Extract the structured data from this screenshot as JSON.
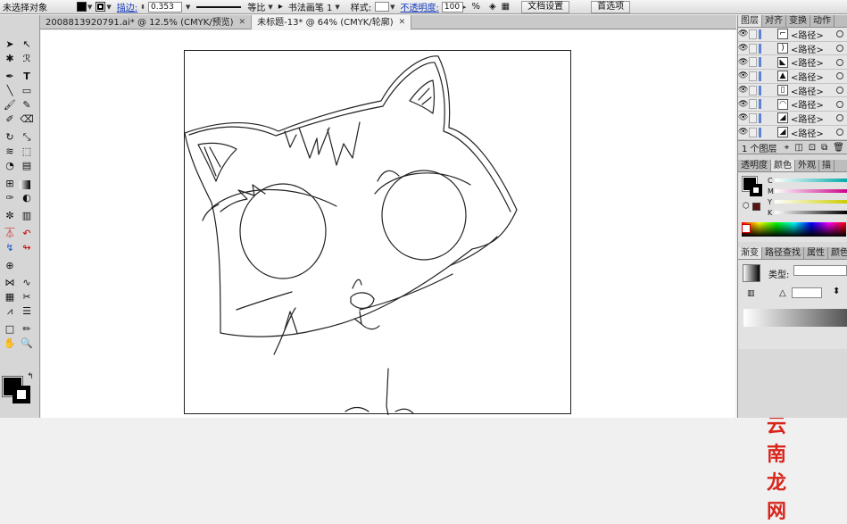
{
  "control_bar": {
    "selection_label": "未选择对象",
    "stroke_label": "描边:",
    "stroke_value": "0.353",
    "profile_label": "等比",
    "brush_label": "书法画笔 1",
    "style_label": "样式:",
    "opacity_label": "不透明度:",
    "opacity_value": "100",
    "percent": "%",
    "doc_setup_button": "文档设置",
    "preferences_button": "首选项"
  },
  "doc_tabs": [
    {
      "label": "2008813920791.ai* @ 12.5% (CMYK/预览)"
    },
    {
      "label": "未标题-13* @ 64% (CMYK/轮廓)"
    }
  ],
  "layers_panel": {
    "tabs": [
      "图层",
      "对齐",
      "变换",
      "动作"
    ],
    "rows": [
      {
        "label": "<路径>"
      },
      {
        "label": "<路径>"
      },
      {
        "label": "<路径>"
      },
      {
        "label": "<路径>"
      },
      {
        "label": "<路径>"
      },
      {
        "label": "<路径>"
      },
      {
        "label": "<路径>"
      },
      {
        "label": "<路径>"
      }
    ],
    "footer": "1 个图层"
  },
  "color_panel": {
    "tabs": [
      "透明度",
      "颜色",
      "外观",
      "描"
    ],
    "channels": [
      "C",
      "M",
      "Y",
      "K"
    ],
    "colors": {
      "fill": "#000000",
      "stroke": "#ffffff"
    }
  },
  "gradient_panel": {
    "tabs": [
      "渐变",
      "路径查找",
      "属性",
      "颜色"
    ],
    "type_label": "类型:"
  },
  "watermark": "云南龙网",
  "icons": {
    "selection": "selection-arrow-icon",
    "direct_selection": "direct-selection-icon",
    "magic_wand": "magic-wand-icon",
    "lasso": "lasso-icon",
    "pen": "pen-icon",
    "type": "type-icon",
    "line": "line-segment-icon",
    "rectangle": "rectangle-icon",
    "paintbrush": "paintbrush-icon",
    "pencil": "pencil-icon",
    "blob_brush": "blob-brush-icon",
    "eraser": "eraser-icon",
    "rotate": "rotate-icon",
    "scale": "scale-icon",
    "width": "width-icon",
    "free_transform": "free-transform-icon",
    "shape_builder": "shape-builder-icon",
    "perspective": "perspective-icon",
    "mesh": "mesh-icon",
    "gradient": "gradient-icon",
    "eyedropper": "eyedropper-icon",
    "blend": "blend-icon",
    "symbol_sprayer": "symbol-sprayer-icon",
    "column_graph": "column-graph-icon",
    "artboard": "artboard-icon",
    "slice": "slice-icon",
    "hand": "hand-icon",
    "zoom": "zoom-icon"
  }
}
